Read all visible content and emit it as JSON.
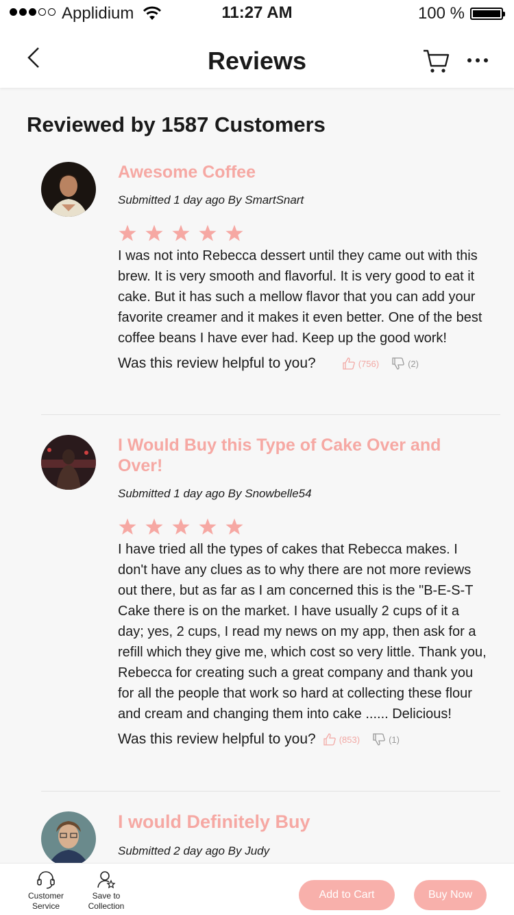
{
  "status_bar": {
    "carrier": "Applidium",
    "time": "11:27 AM",
    "battery": "100 %"
  },
  "nav": {
    "title": "Reviews",
    "icons": [
      "back-chevron-icon",
      "cart-icon",
      "more-icon"
    ]
  },
  "heading": "Reviewed by 1587 Customers",
  "helpful_prompt": "Was this review helpful to you?",
  "colors": {
    "accent": "#f6a8a3",
    "button": "#f8b0ab",
    "background": "#f7f7f7"
  },
  "reviews": [
    {
      "title": "Awesome Coffee",
      "meta": "Submitted 1 day ago By SmartSnart",
      "rating": 5,
      "text": "I was not into Rebecca dessert until they came out with this brew. It is very smooth and flavorful. It is very good to eat it cake. But it has such a mellow flavor that you can add your favorite creamer and it makes it even better. One of the best coffee beans I have ever had. Keep up the good work!",
      "likes": "(756)",
      "dislikes": "(2)"
    },
    {
      "title": "I Would Buy this Type of Cake Over and Over!",
      "meta": "Submitted 1 day ago By Snowbelle54",
      "rating": 5,
      "text": "I have tried all the types of cakes that Rebecca makes. I don't have any clues as to why there are not more reviews out there, but as far as I am concerned this is the \"B-E-S-T Cake there is on the market. I have usually 2 cups of it a day; yes, 2 cups, I read my news on my app, then ask for a refill which they give me, which cost so very little. Thank you, Rebecca for creating such a great company and thank you for all the people that work so hard at collecting these flour and cream and changing them into cake ...... Delicious!",
      "likes": "(853)",
      "dislikes": "(1)"
    },
    {
      "title": "I would Definitely Buy",
      "meta": "Submitted 2 day ago By Judy"
    }
  ],
  "bottom_bar": {
    "customer_service": "Customer Service",
    "save_to_collection": "Save to Collection",
    "add_to_cart": "Add to Cart",
    "buy_now": "Buy Now"
  }
}
